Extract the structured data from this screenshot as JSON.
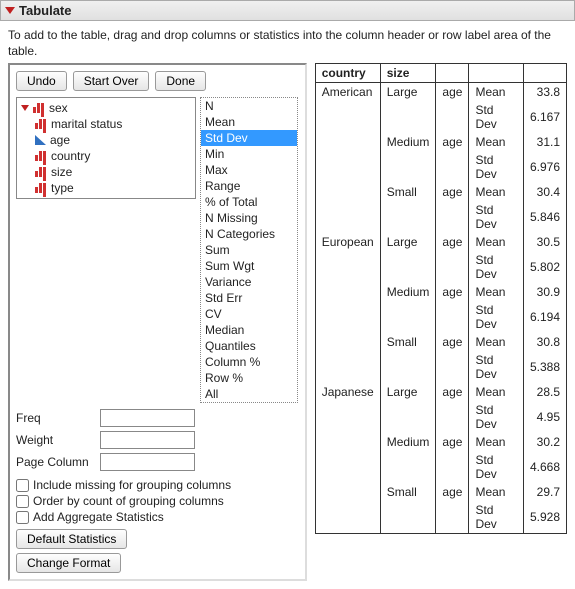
{
  "title": "Tabulate",
  "instructions": "To add to the table, drag and drop columns or statistics into the column header or row label area of the table.",
  "buttons": {
    "undo": "Undo",
    "start_over": "Start Over",
    "done": "Done",
    "default_stats": "Default Statistics",
    "change_format": "Change Format"
  },
  "columns": [
    {
      "name": "sex",
      "type": "nominal"
    },
    {
      "name": "marital status",
      "type": "nominal"
    },
    {
      "name": "age",
      "type": "continuous"
    },
    {
      "name": "country",
      "type": "nominal"
    },
    {
      "name": "size",
      "type": "nominal"
    },
    {
      "name": "type",
      "type": "nominal"
    }
  ],
  "stats": [
    "N",
    "Mean",
    "Std Dev",
    "Min",
    "Max",
    "Range",
    "% of Total",
    "N Missing",
    "N Categories",
    "Sum",
    "Sum Wgt",
    "Variance",
    "Std Err",
    "CV",
    "Median",
    "Quantiles",
    "Column %",
    "Row %",
    "All"
  ],
  "stat_selected": "Std Dev",
  "fields": {
    "freq_label": "Freq",
    "freq_value": "",
    "weight_label": "Weight",
    "weight_value": "",
    "pagecol_label": "Page Column",
    "pagecol_value": ""
  },
  "checks": {
    "include_missing": "Include missing for grouping columns",
    "order_by_count": "Order by count of grouping columns",
    "add_aggregate": "Add Aggregate Statistics"
  },
  "table": {
    "headers": {
      "country": "country",
      "size": "size"
    },
    "rows": [
      {
        "country": "American",
        "size": "Large",
        "var": "age",
        "stat": "Mean",
        "val": "33.8"
      },
      {
        "country": "",
        "size": "",
        "var": "",
        "stat": "Std Dev",
        "val": "6.167"
      },
      {
        "country": "",
        "size": "Medium",
        "var": "age",
        "stat": "Mean",
        "val": "31.1"
      },
      {
        "country": "",
        "size": "",
        "var": "",
        "stat": "Std Dev",
        "val": "6.976"
      },
      {
        "country": "",
        "size": "Small",
        "var": "age",
        "stat": "Mean",
        "val": "30.4"
      },
      {
        "country": "",
        "size": "",
        "var": "",
        "stat": "Std Dev",
        "val": "5.846"
      },
      {
        "country": "European",
        "size": "Large",
        "var": "age",
        "stat": "Mean",
        "val": "30.5"
      },
      {
        "country": "",
        "size": "",
        "var": "",
        "stat": "Std Dev",
        "val": "5.802"
      },
      {
        "country": "",
        "size": "Medium",
        "var": "age",
        "stat": "Mean",
        "val": "30.9"
      },
      {
        "country": "",
        "size": "",
        "var": "",
        "stat": "Std Dev",
        "val": "6.194"
      },
      {
        "country": "",
        "size": "Small",
        "var": "age",
        "stat": "Mean",
        "val": "30.8"
      },
      {
        "country": "",
        "size": "",
        "var": "",
        "stat": "Std Dev",
        "val": "5.388"
      },
      {
        "country": "Japanese",
        "size": "Large",
        "var": "age",
        "stat": "Mean",
        "val": "28.5"
      },
      {
        "country": "",
        "size": "",
        "var": "",
        "stat": "Std Dev",
        "val": "4.95"
      },
      {
        "country": "",
        "size": "Medium",
        "var": "age",
        "stat": "Mean",
        "val": "30.2"
      },
      {
        "country": "",
        "size": "",
        "var": "",
        "stat": "Std Dev",
        "val": "4.668"
      },
      {
        "country": "",
        "size": "Small",
        "var": "age",
        "stat": "Mean",
        "val": "29.7"
      },
      {
        "country": "",
        "size": "",
        "var": "",
        "stat": "Std Dev",
        "val": "5.928"
      }
    ]
  }
}
